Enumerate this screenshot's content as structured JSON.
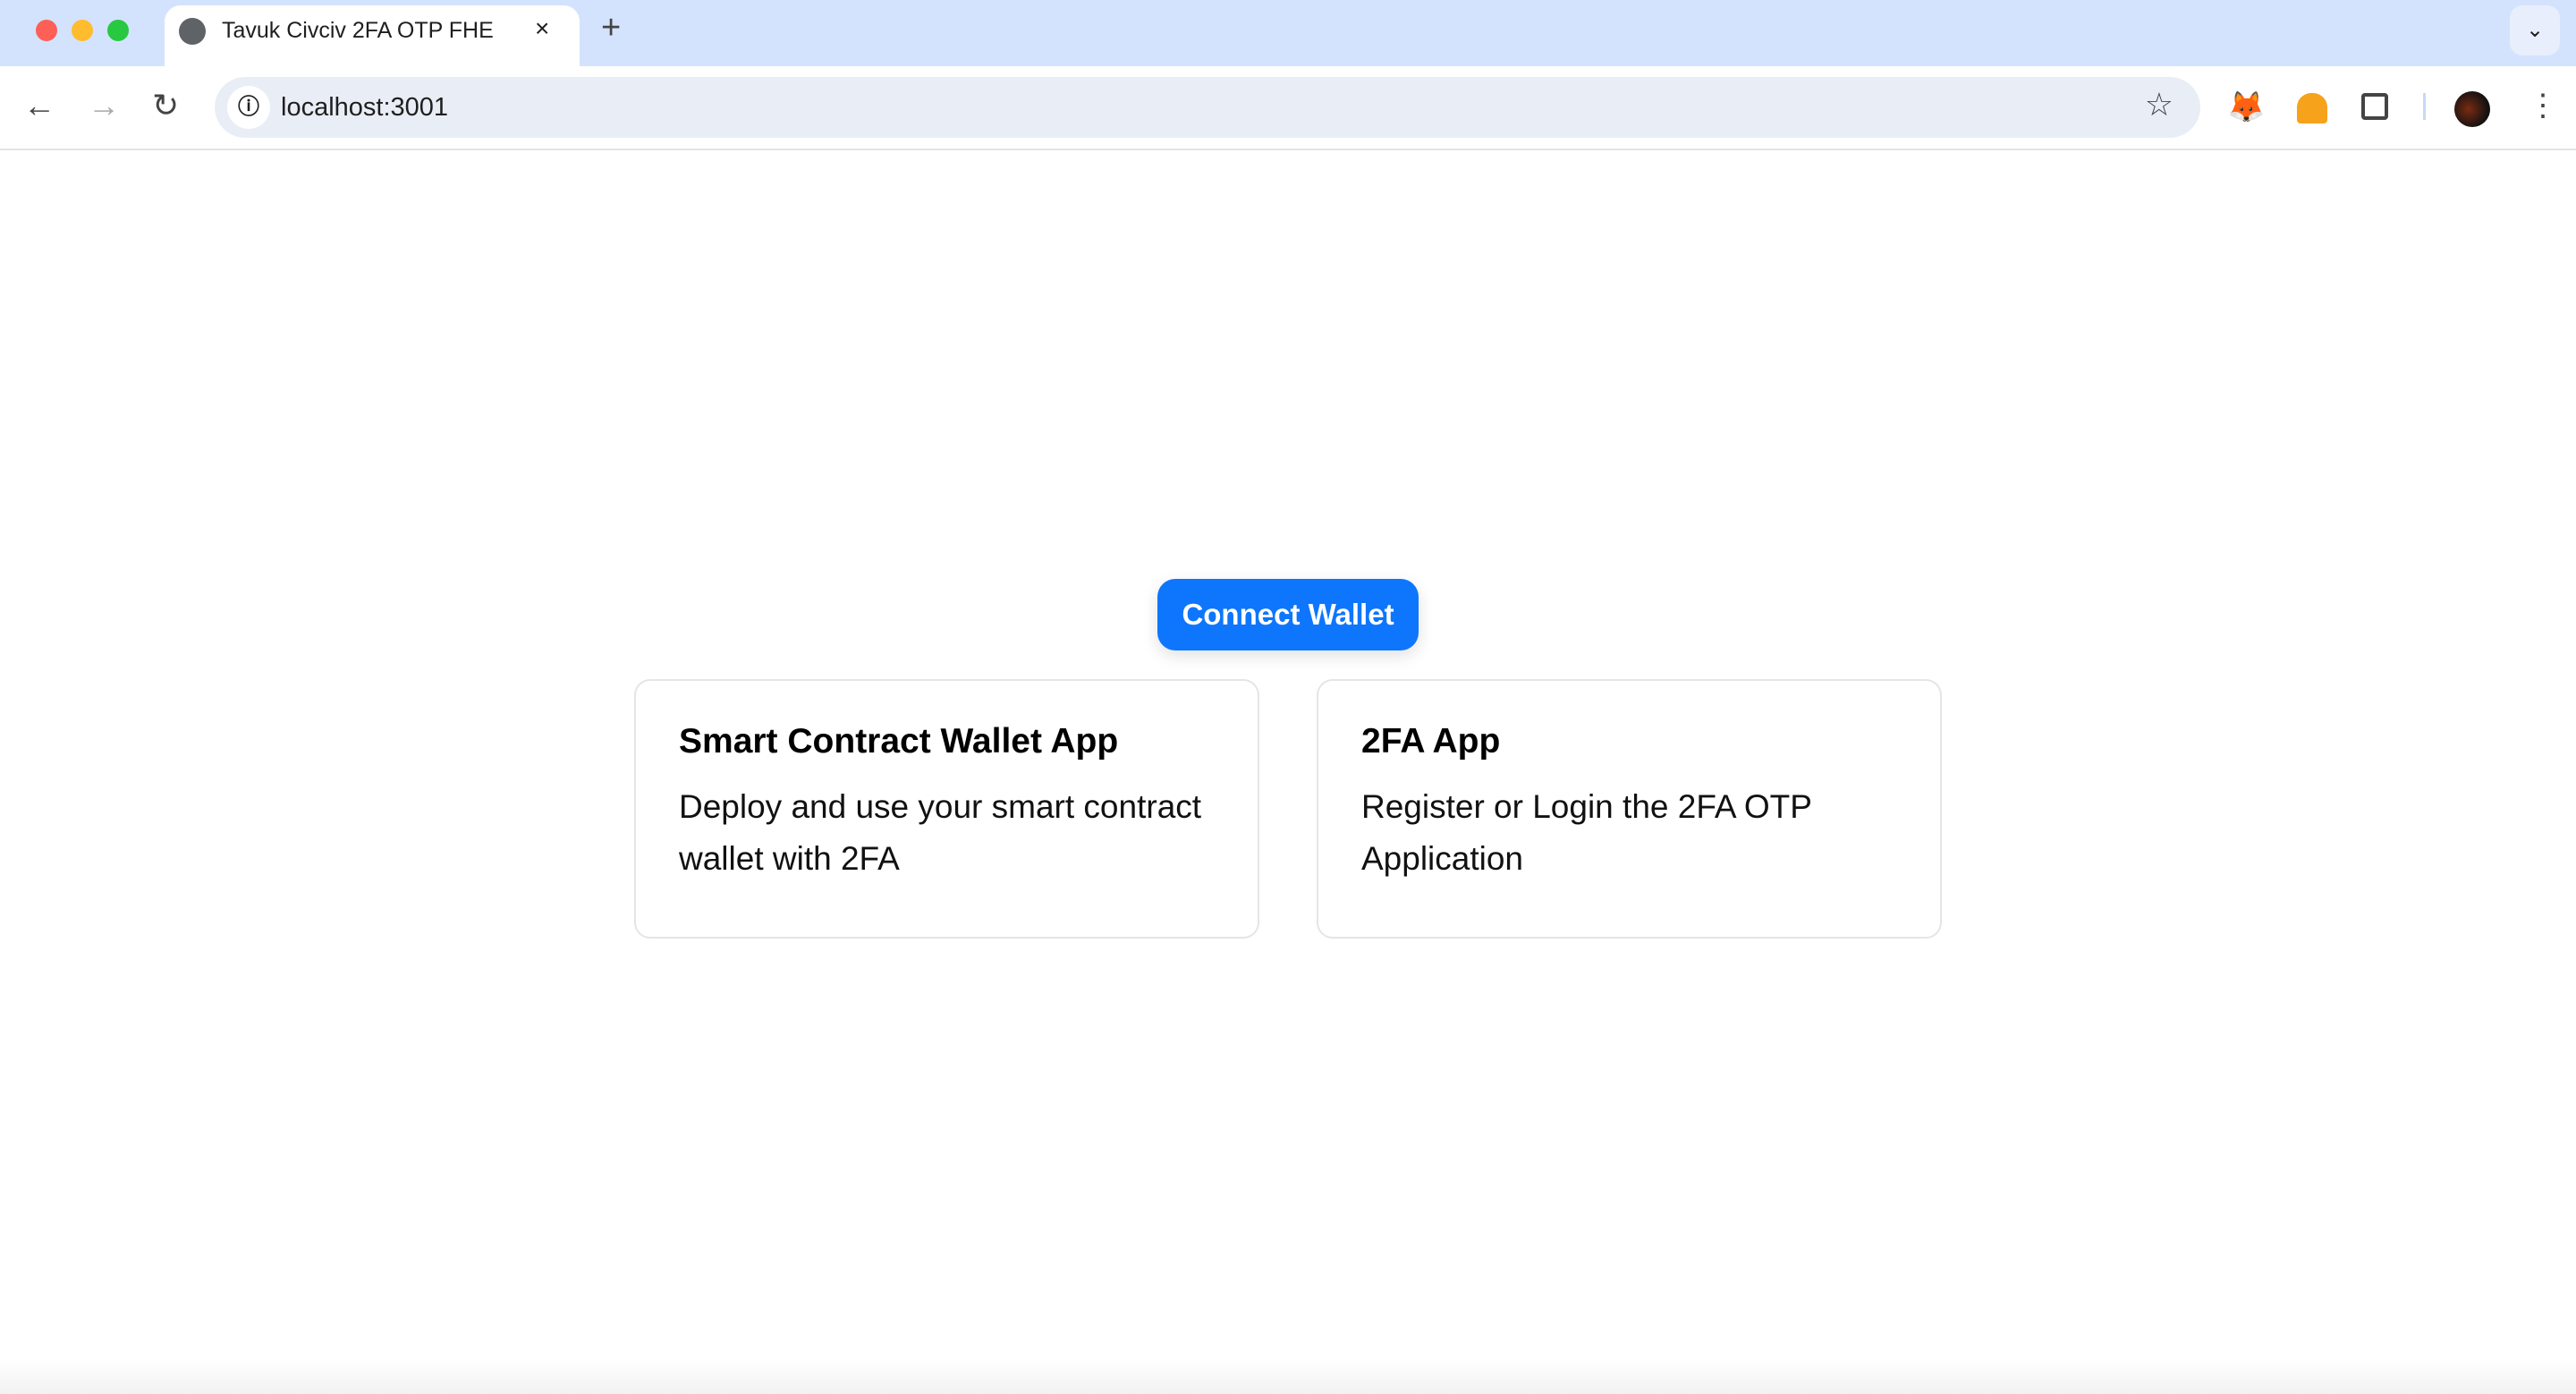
{
  "browser": {
    "tab_title": "Tavuk Civciv 2FA OTP FHE",
    "close_tab": "×",
    "new_tab": "+",
    "tab_dropdown": "⌄",
    "url": "localhost:3001",
    "icons": [
      "globe-icon",
      "back-arrow-icon",
      "forward-arrow-icon",
      "reload-icon",
      "info-icon",
      "star-icon",
      "metamask-fox-icon",
      "helmet-extension-icon",
      "puzzle-extensions-icon",
      "profile-avatar",
      "more-menu-icon"
    ]
  },
  "main": {
    "connect_button": "Connect Wallet",
    "accent": "#0e76fd",
    "cards": [
      {
        "title": "Smart Contract Wallet App",
        "description": "Deploy and use your smart contract wallet with 2FA"
      },
      {
        "title": "2FA App",
        "description": "Register or Login the 2FA OTP Application"
      }
    ]
  }
}
